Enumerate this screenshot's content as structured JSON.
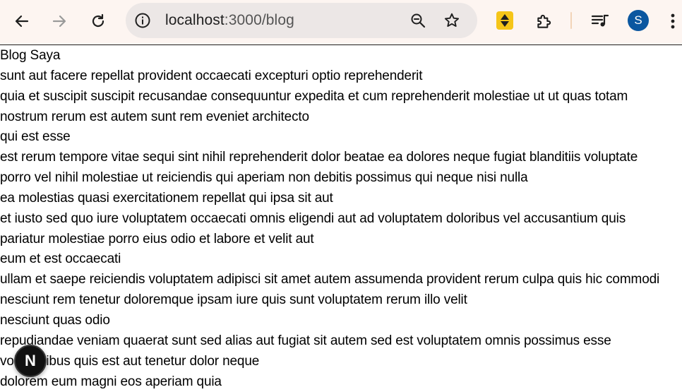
{
  "browser": {
    "url_host": "localhost",
    "url_path": ":3000/blog",
    "profile_initial": "S"
  },
  "icons": {
    "back": "arrow-left-icon",
    "forward": "arrow-right-icon",
    "reload": "reload-icon",
    "site_info": "info-icon",
    "zoom": "zoom-out-icon",
    "bookmark": "star-icon",
    "extension": "extension-updown-icon",
    "extensions": "puzzle-icon",
    "media": "media-queue-icon",
    "menu": "kebab-menu-icon"
  },
  "page": {
    "heading": "Blog Saya",
    "lines": [
      "sunt aut facere repellat provident occaecati excepturi optio reprehenderit",
      "quia et suscipit suscipit recusandae consequuntur expedita et cum reprehenderit molestiae ut ut quas totam",
      "nostrum rerum est autem sunt rem eveniet architecto",
      "qui est esse",
      "est rerum tempore vitae sequi sint nihil reprehenderit dolor beatae ea dolores neque fugiat blanditiis voluptate",
      "porro vel nihil molestiae ut reiciendis qui aperiam non debitis possimus qui neque nisi nulla",
      "ea molestias quasi exercitationem repellat qui ipsa sit aut",
      "et iusto sed quo iure voluptatem occaecati omnis eligendi aut ad voluptatem doloribus vel accusantium quis",
      "pariatur molestiae porro eius odio et labore et velit aut",
      "eum et est occaecati",
      "ullam et saepe reiciendis voluptatem adipisci sit amet autem assumenda provident rerum culpa quis hic commodi",
      "nesciunt rem tenetur doloremque ipsam iure quis sunt voluptatem rerum illo velit",
      "nesciunt quas odio",
      "repudiandae veniam quaerat sunt sed alias aut fugiat sit autem sed est voluptatem omnis possimus esse",
      "voluptatibus quis est aut tenetur dolor neque",
      "dolorem eum magni eos aperiam quia"
    ]
  },
  "dev_indicator": {
    "label": "N"
  },
  "colors": {
    "toolbar_bg": "#fdf5f1",
    "omnibox_bg": "#ece7e6",
    "avatar_bg": "#0b57a0",
    "extension_yellow": "#f5c518"
  }
}
